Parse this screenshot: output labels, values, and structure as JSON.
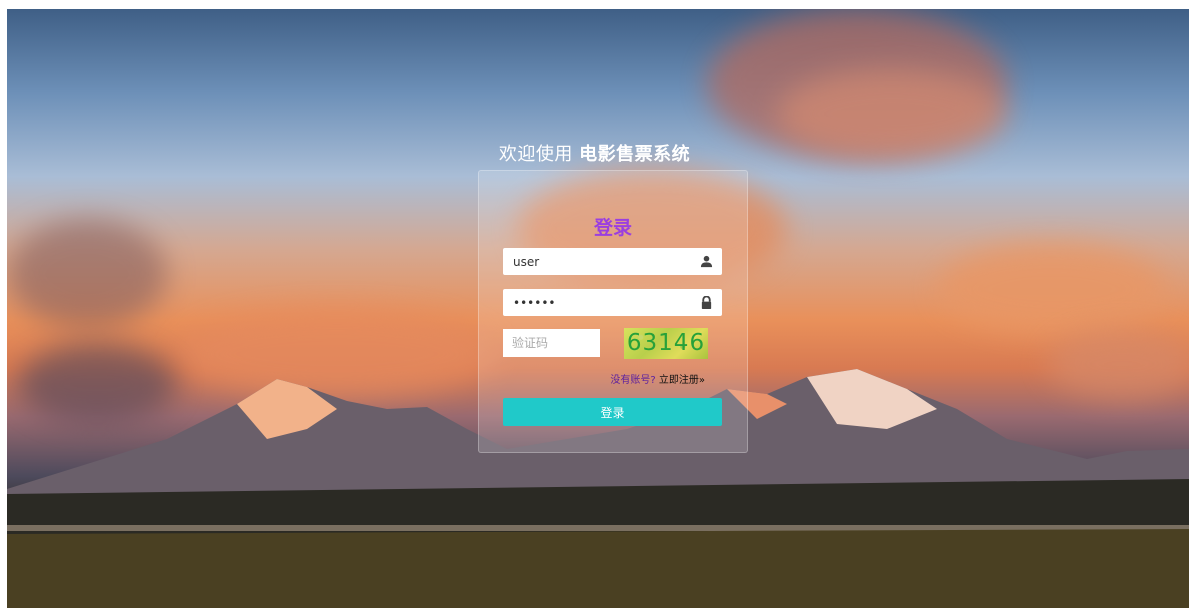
{
  "page": {
    "welcome_prefix": "欢迎使用",
    "system_name": "电影售票系统"
  },
  "login_form": {
    "heading": "登录",
    "username_value": "user",
    "password_value": "••••••",
    "captcha_placeholder": "验证码",
    "captcha_code": "63146",
    "no_account_text": "没有账号?",
    "register_link": "立即注册»",
    "submit_label": "登录",
    "icons": {
      "username": "user-icon",
      "password": "lock-icon"
    }
  },
  "colors": {
    "heading": "#9b3fe0",
    "submit_bg": "#20c9c9",
    "captcha_text": "#27a13a"
  }
}
